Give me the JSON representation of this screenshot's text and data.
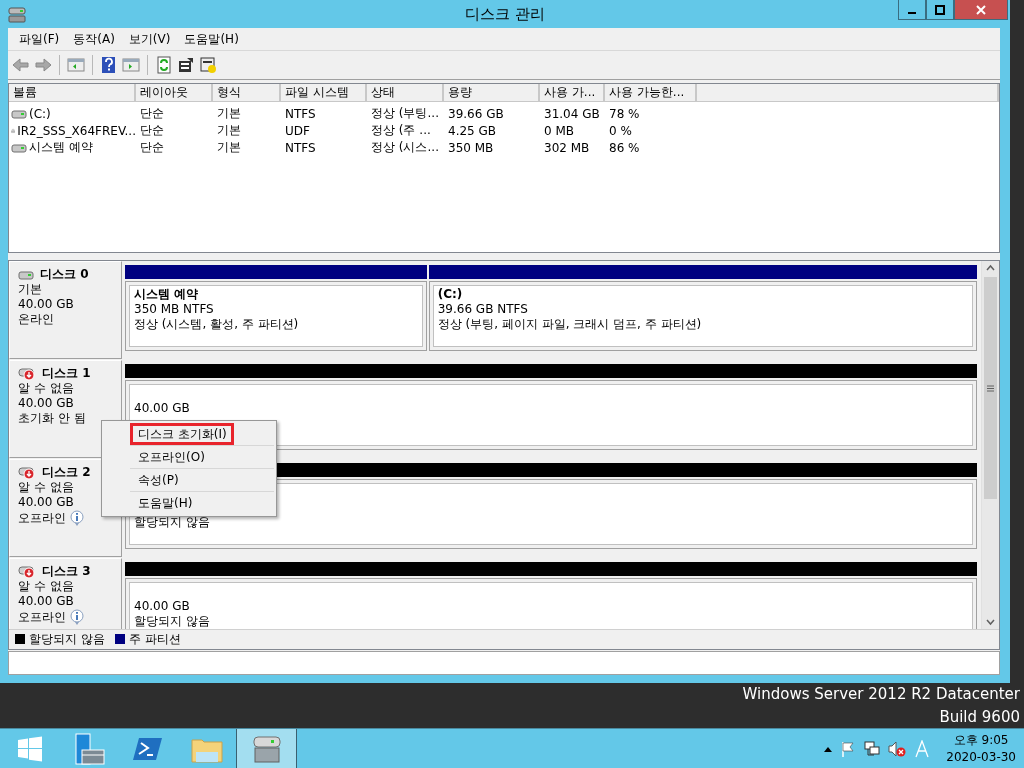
{
  "window": {
    "title": "디스크 관리"
  },
  "menu": [
    "파일(F)",
    "동작(A)",
    "보기(V)",
    "도움말(H)"
  ],
  "volumes": {
    "columns": [
      "볼륨",
      "레이아웃",
      "형식",
      "파일 시스템",
      "상태",
      "용량",
      "사용 가...",
      "사용 가능한..."
    ],
    "rows": [
      {
        "kind": "drive",
        "cells": [
          "(C:)",
          "단순",
          "기본",
          "NTFS",
          "정상 (부팅...",
          "39.66 GB",
          "31.04 GB",
          "78 %"
        ]
      },
      {
        "kind": "disc",
        "cells": [
          "IR2_SSS_X64FREV...",
          "단순",
          "기본",
          "UDF",
          "정상 (주 ...",
          "4.25 GB",
          "0 MB",
          "0 %"
        ]
      },
      {
        "kind": "drive",
        "cells": [
          "시스템 예약",
          "단순",
          "기본",
          "NTFS",
          "정상 (시스...",
          "350 MB",
          "302 MB",
          "86 %"
        ]
      }
    ]
  },
  "disks": [
    {
      "kind": "basic",
      "name": "디스크 0",
      "lines": [
        "기본",
        "40.00 GB",
        "온라인"
      ],
      "info": false,
      "partitions": [
        {
          "kind": "primary",
          "name": "시스템 예약",
          "size": "350 MB NTFS",
          "status": "정상 (시스템, 활성, 주 파티션)"
        },
        {
          "kind": "primary",
          "name": "(C:)",
          "size": "39.66 GB NTFS",
          "status": "정상 (부팅, 페이지 파일, 크래시 덤프, 주 파티션)"
        }
      ]
    },
    {
      "kind": "unknown",
      "name": "디스크 1",
      "lines": [
        "알 수 없음",
        "40.00 GB",
        "초기화 안 됨"
      ],
      "info": false,
      "partitions": [
        {
          "kind": "unallocated",
          "size": "40.00 GB"
        }
      ]
    },
    {
      "kind": "unknown",
      "name": "디스크 2",
      "lines": [
        "알 수 없음",
        "40.00 GB",
        "오프라인"
      ],
      "info": true,
      "partitions": [
        {
          "kind": "unallocated",
          "status": "할당되지 않음"
        }
      ]
    },
    {
      "kind": "unknown",
      "name": "디스크 3",
      "lines": [
        "알 수 없음",
        "40.00 GB",
        "오프라인"
      ],
      "info": true,
      "partitions": [
        {
          "kind": "unallocated",
          "size": "40.00 GB",
          "status": "할당되지 않음"
        }
      ]
    }
  ],
  "legend": [
    {
      "label": "할당되지 않음",
      "color": "#000000"
    },
    {
      "label": "주 파티션",
      "color": "#000080"
    }
  ],
  "context_menu": [
    {
      "label": "디스크 초기화(I)",
      "highlighted": true
    },
    {
      "label": "오프라인(O)",
      "highlighted": false
    },
    {
      "label": "속성(P)",
      "highlighted": false
    },
    {
      "label": "도움말(H)",
      "highlighted": false
    }
  ],
  "desktop": {
    "edition": "Windows Server 2012 R2 Datacenter",
    "build": "Build 9600"
  },
  "taskbar": {
    "apps": [
      {
        "kind": "start",
        "selected": false
      },
      {
        "kind": "server-manager",
        "selected": false
      },
      {
        "kind": "powershell",
        "selected": false
      },
      {
        "kind": "explorer",
        "selected": false
      },
      {
        "kind": "disk-management",
        "selected": true
      }
    ],
    "time": "오후 9:05",
    "date": "2020-03-30"
  }
}
